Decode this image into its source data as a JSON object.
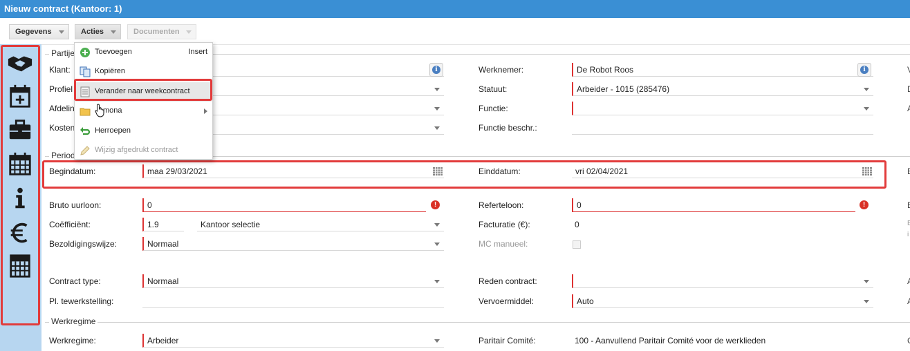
{
  "window": {
    "title": "Nieuw contract (Kantoor: 1)"
  },
  "toolbar": {
    "gegevens": "Gegevens",
    "acties": "Acties",
    "documenten": "Documenten"
  },
  "sidebar": {
    "icons": [
      "handshake-icon",
      "calendar-add-icon",
      "briefcase-icon",
      "calendar-icon",
      "info-icon",
      "euro-icon",
      "calculator-icon"
    ],
    "highlight_color": "#e23b3b"
  },
  "sections": {
    "partijen": "Partije",
    "periode": "Period",
    "werkregime": "Werkregime"
  },
  "fields": {
    "klant_label": "Klant:",
    "profiel_label": "Profiel",
    "afdeling_label": "Afdelin",
    "kosten_label": "Kosten",
    "werknemer_label": "Werknemer:",
    "werknemer_value": "De Robot Roos",
    "statuut_label": "Statuut:",
    "statuut_value": "Arbeider - 1015 (285476)",
    "functie_label": "Functie:",
    "functie_value": "",
    "functie_beschr_label": "Functie beschr.:",
    "begindatum_label": "Begindatum:",
    "begindatum_value": "maa 29/03/2021",
    "einddatum_label": "Einddatum:",
    "einddatum_value": "vri 02/04/2021",
    "bruto_label": "Bruto uurloon:",
    "bruto_value": "0",
    "referteloon_label": "Referteloon:",
    "referteloon_value": "0",
    "coef_label": "Coëfficiënt:",
    "coef_value": "1.9",
    "kantoor_value": "Kantoor selectie",
    "facturatie_label": "Facturatie (€):",
    "facturatie_value": "0",
    "bezoldiging_label": "Bezoldigingswijze:",
    "bezoldiging_value": "Normaal",
    "mc_label": "MC manueel:",
    "contract_type_label": "Contract type:",
    "contract_type_value": "Normaal",
    "reden_label": "Reden contract:",
    "reden_value": "",
    "pl_label": "Pl. tewerkstelling:",
    "pl_value": "",
    "vervoer_label": "Vervoermiddel:",
    "vervoer_value": "Auto",
    "werkregime_label": "Werkregime:",
    "werkregime_value": "Arbeider",
    "pc_label": "Paritair Comité:",
    "pc_value": "100 - Aanvullend Paritair Comité voor de werklieden"
  },
  "cutoff_letters": [
    "V",
    "D",
    "A",
    "E",
    "E",
    "E",
    "i",
    "A",
    "A",
    "C"
  ],
  "menu": {
    "items": [
      {
        "label": "Toevoegen",
        "shortcut": "Insert",
        "icon": "add-icon"
      },
      {
        "label": "Kopiëren",
        "icon": "copy-icon"
      },
      {
        "label": "Verander naar weekcontract",
        "icon": "document-icon"
      },
      {
        "label": "mona",
        "icon": "folder-icon"
      },
      {
        "label": "Herroepen",
        "icon": "undo-icon"
      },
      {
        "label": "Wijzig afgedrukt contract",
        "icon": "pencil-icon"
      }
    ]
  },
  "colors": {
    "titlebar": "#3a8fd4",
    "sidebar": "#b7d6f0",
    "required": "#d33333",
    "highlight": "#e23b3b"
  }
}
